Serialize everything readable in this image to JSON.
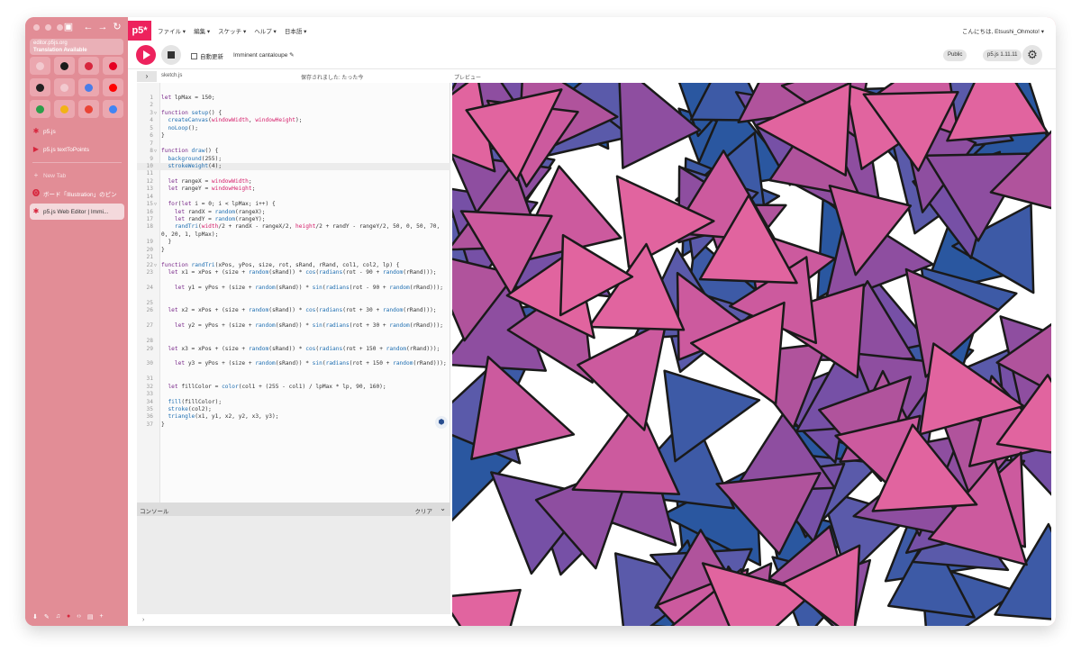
{
  "browser": {
    "url": "editor.p5js.org",
    "translation": "Translation Available",
    "favorites": [
      {
        "icon": "p5-icon",
        "color": "#f2c9cf"
      },
      {
        "icon": "github-icon",
        "color": "#1b1b1b"
      },
      {
        "icon": "shield-icon",
        "color": "#d7263d"
      },
      {
        "icon": "pinterest-icon",
        "color": "#e60023"
      },
      {
        "icon": "openai-icon",
        "color": "#222222"
      },
      {
        "icon": "globe-icon",
        "color": "#f2c9cf"
      },
      {
        "icon": "gemini-icon",
        "color": "#4a7de8"
      },
      {
        "icon": "youtube-icon",
        "color": "#ff0000"
      },
      {
        "icon": "drive-icon",
        "color": "#2d9d4a"
      },
      {
        "icon": "drive2-icon",
        "color": "#f2b316"
      },
      {
        "icon": "gmail-icon",
        "color": "#ea4335"
      },
      {
        "icon": "photos-icon",
        "color": "#4285f4"
      }
    ],
    "tabs": [
      {
        "label": "p5.js",
        "icon": "p5-star-icon"
      },
      {
        "label": "p5.js textToPoints",
        "icon": "youtube-icon"
      }
    ],
    "new_tab": "New Tab",
    "open_tabs": [
      {
        "label": "ボード「Illustration」のピン",
        "icon": "pinterest-icon"
      },
      {
        "label": "p5.js Web Editor | Immi...",
        "icon": "p5-star-icon"
      }
    ]
  },
  "app": {
    "logo": "p5*",
    "menu": [
      "ファイル ▾",
      "編集 ▾",
      "スケッチ ▾",
      "ヘルプ ▾",
      "日本語 ▾"
    ],
    "greeting": "こんにちは, Etsushi_Ohmoto! ▾",
    "auto_refresh": "自動更新",
    "sketch_name": "Imminent cantaloupe ✎",
    "visibility": "Public",
    "version": "p5.js 1.11.11",
    "file_name": "sketch.js",
    "saved_status": "保存されました: たった今",
    "preview_label": "プレビュー",
    "console_label": "コンソール",
    "clear_label": "クリア"
  },
  "code": [
    {
      "n": "1",
      "t": "let lpMax = 150;"
    },
    {
      "n": "2",
      "t": ""
    },
    {
      "n": "3",
      "t": "function setup() {",
      "fold": true
    },
    {
      "n": "4",
      "t": "  createCanvas(windowWidth, windowHeight);"
    },
    {
      "n": "5",
      "t": "  noLoop();"
    },
    {
      "n": "6",
      "t": "}"
    },
    {
      "n": "7",
      "t": ""
    },
    {
      "n": "8",
      "t": "function draw() {",
      "fold": true
    },
    {
      "n": "9",
      "t": "  background(255);"
    },
    {
      "n": "10",
      "t": "  strokeWeight(4);",
      "hl": true
    },
    {
      "n": "11",
      "t": ""
    },
    {
      "n": "12",
      "t": "  let rangeX = windowWidth;"
    },
    {
      "n": "13",
      "t": "  let rangeY = windowHeight;"
    },
    {
      "n": "14",
      "t": ""
    },
    {
      "n": "15",
      "t": "  for(let i = 0; i < lpMax; i++) {",
      "fold": true
    },
    {
      "n": "16",
      "t": "    let randX = random(rangeX);"
    },
    {
      "n": "17",
      "t": "    let randY = random(rangeY);"
    },
    {
      "n": "18",
      "t": "    randTri(width/2 + randX - rangeX/2, height/2 + randY - rangeY/2, 50, 0, 50, 70, 0, 20, 1, lpMax);",
      "wrap": true
    },
    {
      "n": "19",
      "t": "  }"
    },
    {
      "n": "20",
      "t": "}"
    },
    {
      "n": "21",
      "t": ""
    },
    {
      "n": "22",
      "t": "function randTri(xPos, yPos, size, rot, sRand, rRand, col1, col2, lp) {",
      "fold": true
    },
    {
      "n": "23",
      "t": "  let x1 = xPos + (size + random(sRand)) * cos(radians(rot - 90 + random(rRand)));",
      "wrap": true
    },
    {
      "n": "24",
      "t": "    let y1 = yPos + (size + random(sRand)) * sin(radians(rot - 90 + random(rRand)));",
      "wrap": true
    },
    {
      "n": "25",
      "t": ""
    },
    {
      "n": "26",
      "t": "  let x2 = xPos + (size + random(sRand)) * cos(radians(rot + 30 + random(rRand)));",
      "wrap": true
    },
    {
      "n": "27",
      "t": "    let y2 = yPos + (size + random(sRand)) * sin(radians(rot + 30 + random(rRand)));",
      "wrap": true
    },
    {
      "n": "28",
      "t": ""
    },
    {
      "n": "29",
      "t": "  let x3 = xPos + (size + random(sRand)) * cos(radians(rot + 150 + random(rRand)));",
      "wrap": true
    },
    {
      "n": "30",
      "t": "    let y3 = yPos + (size + random(sRand)) * sin(radians(rot + 150 + random(rRand)));",
      "wrap": true
    },
    {
      "n": "31",
      "t": ""
    },
    {
      "n": "32",
      "t": "  let fillColor = color(col1 + (255 - col1) / lpMax * lp, 90, 160);"
    },
    {
      "n": "33",
      "t": ""
    },
    {
      "n": "34",
      "t": "  fill(fillColor);"
    },
    {
      "n": "35",
      "t": "  stroke(col2);"
    },
    {
      "n": "36",
      "t": "  triangle(x1, y1, x2, y2, x3, y3);"
    },
    {
      "n": "37",
      "t": "}"
    }
  ],
  "palette": {
    "accent": "#ed225d",
    "tri_colors": [
      "#2a57a0",
      "#3d5aa6",
      "#5a5aaa",
      "#7650a6",
      "#8e4ea0",
      "#b0539c",
      "#cc5a9e",
      "#e1649f"
    ],
    "sidebar": "#e28d96"
  }
}
